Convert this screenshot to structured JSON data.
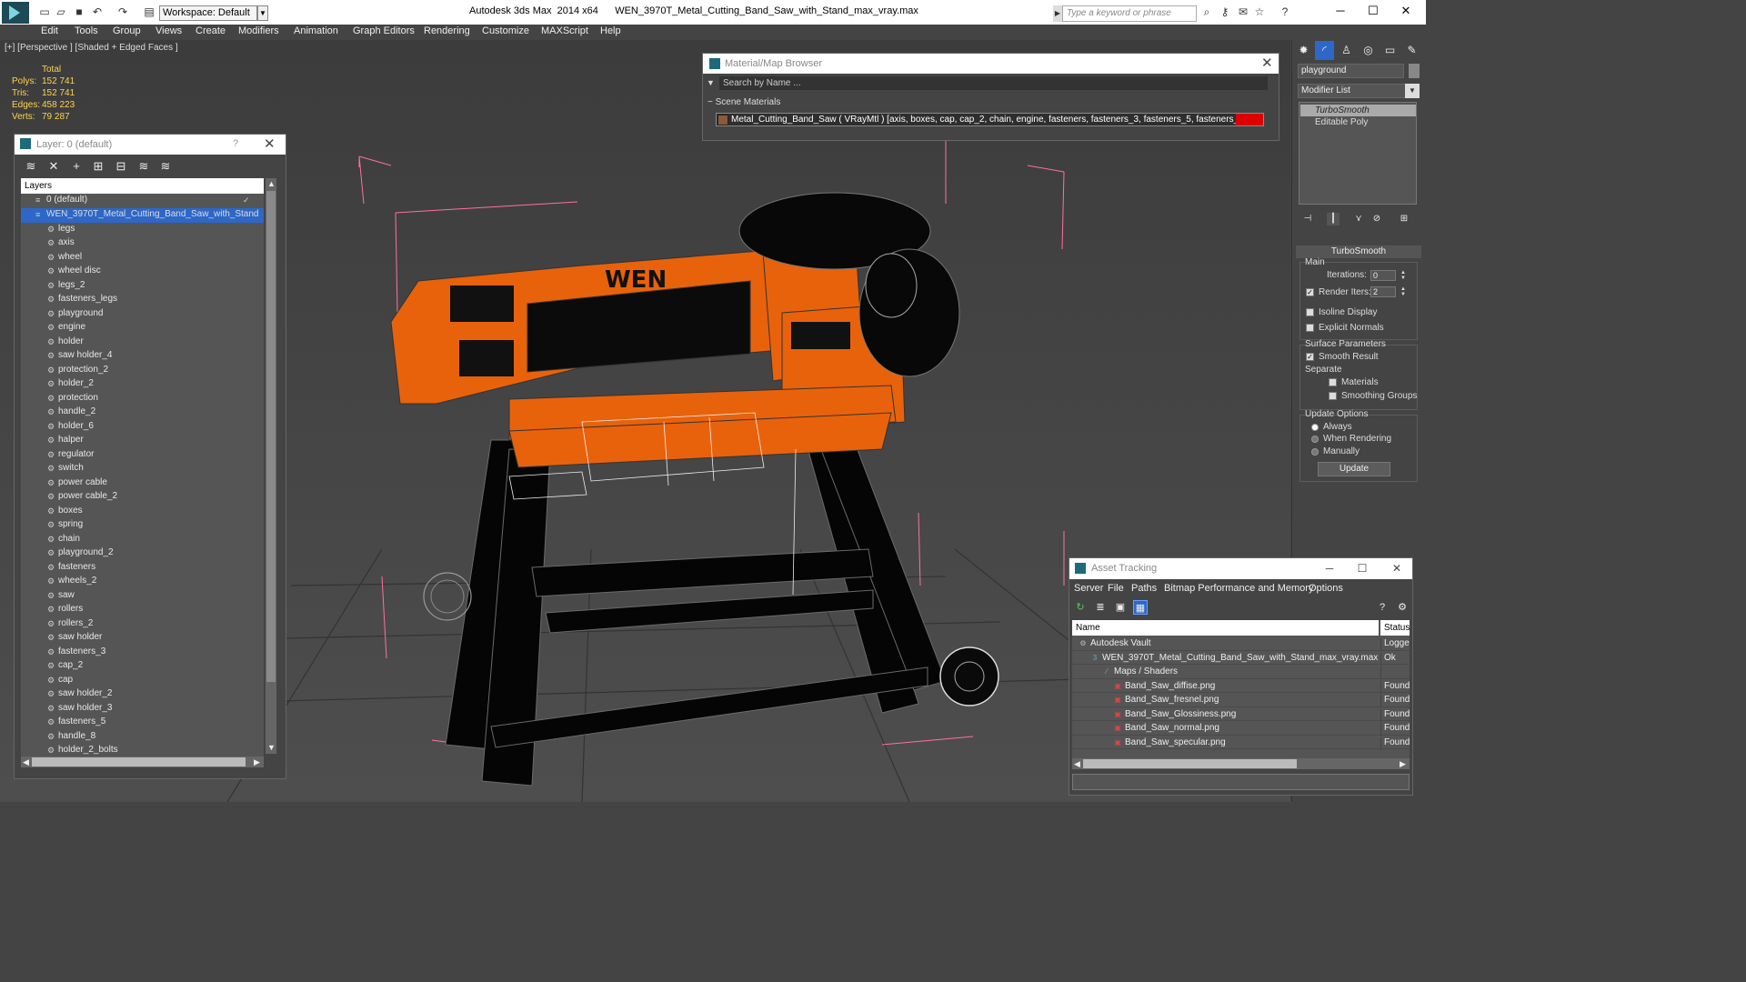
{
  "title_bar": {
    "workspace": "Workspace: Default",
    "app_title": "Autodesk 3ds Max  2014 x64      WEN_3970T_Metal_Cutting_Band_Saw_with_Stand_max_vray.max",
    "search_placeholder": "Type a keyword or phrase"
  },
  "menu": [
    "Edit",
    "Tools",
    "Group",
    "Views",
    "Create",
    "Modifiers",
    "Animation",
    "Graph Editors",
    "Rendering",
    "Customize",
    "MAXScript",
    "Help"
  ],
  "viewport": {
    "label": "[+] [Perspective ] [Shaded + Edged Faces ]",
    "stats": {
      "header": "Total",
      "rows": [
        {
          "label": "Polys:",
          "value": "152 741"
        },
        {
          "label": "Tris:",
          "value": "152 741"
        },
        {
          "label": "Edges:",
          "value": "458 223"
        },
        {
          "label": "Verts:",
          "value": "79 287"
        }
      ]
    },
    "brand_text": "WEN",
    "colors": {
      "saw_body": "#e8620c",
      "stand": "#050505",
      "wire": "#e8e8e8",
      "bbox": "#ff6fa6",
      "grid": "#2d2d2d"
    }
  },
  "layer_dialog": {
    "title": "Layer: 0 (default)",
    "help": "?",
    "column_header": "Layers",
    "default_layer": "0 (default)",
    "selected_layer": "WEN_3970T_Metal_Cutting_Band_Saw_with_Stand",
    "objects": [
      "legs",
      "axis",
      "wheel",
      "wheel disc",
      "legs_2",
      "fasteners_legs",
      "playground",
      "engine",
      "holder",
      "saw holder_4",
      "protection_2",
      "holder_2",
      "protection",
      "handle_2",
      "holder_6",
      "halper",
      "regulator",
      "switch",
      "power cable",
      "power cable_2",
      "boxes",
      "spring",
      "chain",
      "playground_2",
      "fasteners",
      "wheels_2",
      "saw",
      "rollers",
      "rollers_2",
      "saw holder",
      "fasteners_3",
      "cap_2",
      "cap",
      "saw holder_2",
      "saw holder_3",
      "fasteners_5",
      "handle_8",
      "holder_2_bolts"
    ]
  },
  "material_browser": {
    "title": "Material/Map Browser",
    "search_placeholder": "Search by Name ...",
    "section": "Scene Materials",
    "item": "Metal_Cutting_Band_Saw  ( VRayMtl )  [axis, boxes, cap, cap_2, chain, engine, fasteners, fasteners_3, fasteners_5, fasteners_legs, fasteners..."
  },
  "command_panel": {
    "object_name": "playground",
    "modifier_list": "Modifier List",
    "stack": [
      "TurboSmooth",
      "Editable Poly"
    ],
    "rollout_title": "TurboSmooth",
    "main_group": "Main",
    "iterations_label": "Iterations:",
    "iterations_value": "0",
    "render_iters_label": "Render Iters:",
    "render_iters_value": "2",
    "isoline_label": "Isoline Display",
    "explicit_normals_label": "Explicit Normals",
    "surface_group": "Surface Parameters",
    "smooth_result_label": "Smooth Result",
    "separate_label": "Separate",
    "materials_label": "Materials",
    "smoothing_groups_label": "Smoothing Groups",
    "update_group": "Update Options",
    "always_label": "Always",
    "when_rendering_label": "When Rendering",
    "manually_label": "Manually",
    "update_button": "Update",
    "render_iters_checked": true,
    "smooth_result_checked": true,
    "update_mode": "Always"
  },
  "asset_tracking": {
    "title": "Asset Tracking",
    "menu": [
      "Server",
      "File",
      "Paths",
      "Bitmap Performance and Memory",
      "Options"
    ],
    "columns": [
      "Name",
      "Status"
    ],
    "rows": [
      {
        "name": "Autodesk Vault",
        "status": "Logged",
        "icon": "vault-icon"
      },
      {
        "name": "WEN_3970T_Metal_Cutting_Band_Saw_with_Stand_max_vray.max",
        "status": "Ok",
        "icon": "max-file-icon"
      },
      {
        "name": "Maps / Shaders",
        "status": "",
        "icon": "maps-icon"
      },
      {
        "name": "Band_Saw_diffise.png",
        "status": "Found",
        "icon": "png-icon"
      },
      {
        "name": "Band_Saw_fresnel.png",
        "status": "Found",
        "icon": "png-icon"
      },
      {
        "name": "Band_Saw_Glossiness.png",
        "status": "Found",
        "icon": "png-icon"
      },
      {
        "name": "Band_Saw_normal.png",
        "status": "Found",
        "icon": "png-icon"
      },
      {
        "name": "Band_Saw_specular.png",
        "status": "Found",
        "icon": "png-icon"
      }
    ]
  }
}
